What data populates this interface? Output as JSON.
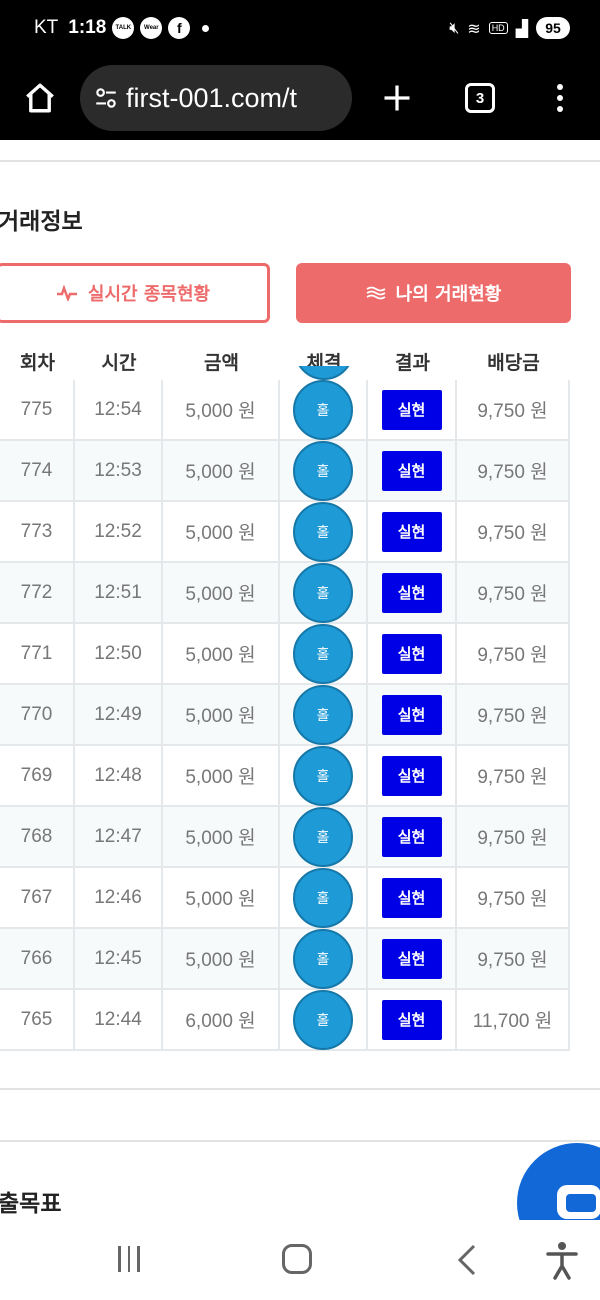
{
  "status_bar": {
    "carrier": "KT",
    "time": "1:18",
    "app_icons": [
      "TALK",
      "Wear"
    ],
    "hd": "HD",
    "battery": "95"
  },
  "browser": {
    "url": "first-001.com/t",
    "tab_count": "3"
  },
  "page": {
    "section_title": "거래정보",
    "button_live": "실시간 종목현황",
    "button_mine": "나의 거래현황",
    "columns": [
      "회차",
      "시간",
      "금액",
      "체결",
      "결과",
      "배당금"
    ],
    "rows": [
      {
        "round": "775",
        "time": "12:54",
        "amount": "5,000 원",
        "fill": "홀",
        "result": "실현",
        "payout": "9,750 원"
      },
      {
        "round": "774",
        "time": "12:53",
        "amount": "5,000 원",
        "fill": "홀",
        "result": "실현",
        "payout": "9,750 원"
      },
      {
        "round": "773",
        "time": "12:52",
        "amount": "5,000 원",
        "fill": "홀",
        "result": "실현",
        "payout": "9,750 원"
      },
      {
        "round": "772",
        "time": "12:51",
        "amount": "5,000 원",
        "fill": "홀",
        "result": "실현",
        "payout": "9,750 원"
      },
      {
        "round": "771",
        "time": "12:50",
        "amount": "5,000 원",
        "fill": "홀",
        "result": "실현",
        "payout": "9,750 원"
      },
      {
        "round": "770",
        "time": "12:49",
        "amount": "5,000 원",
        "fill": "홀",
        "result": "실현",
        "payout": "9,750 원"
      },
      {
        "round": "769",
        "time": "12:48",
        "amount": "5,000 원",
        "fill": "홀",
        "result": "실현",
        "payout": "9,750 원"
      },
      {
        "round": "768",
        "time": "12:47",
        "amount": "5,000 원",
        "fill": "홀",
        "result": "실현",
        "payout": "9,750 원"
      },
      {
        "round": "767",
        "time": "12:46",
        "amount": "5,000 원",
        "fill": "홀",
        "result": "실현",
        "payout": "9,750 원"
      },
      {
        "round": "766",
        "time": "12:45",
        "amount": "5,000 원",
        "fill": "홀",
        "result": "실현",
        "payout": "9,750 원"
      },
      {
        "round": "765",
        "time": "12:44",
        "amount": "6,000 원",
        "fill": "홀",
        "result": "실현",
        "payout": "11,700 원"
      }
    ],
    "section_title_2": "출목표"
  },
  "colors": {
    "accent": "#ee6b6b",
    "fill_circle": "#1e9ad6",
    "result_badge": "#0000e6",
    "chat_fab": "#1268d6"
  },
  "icons": {
    "home": "home-icon",
    "site_settings": "tune-icon",
    "new_tab": "plus-icon",
    "menu": "more-vert-icon",
    "live": "pulse-icon",
    "mine": "waves-icon",
    "chat": "chat-icon",
    "nav_recent": "recent-apps-icon",
    "nav_home": "nav-home-icon",
    "nav_back": "back-icon",
    "nav_access": "accessibility-icon"
  }
}
